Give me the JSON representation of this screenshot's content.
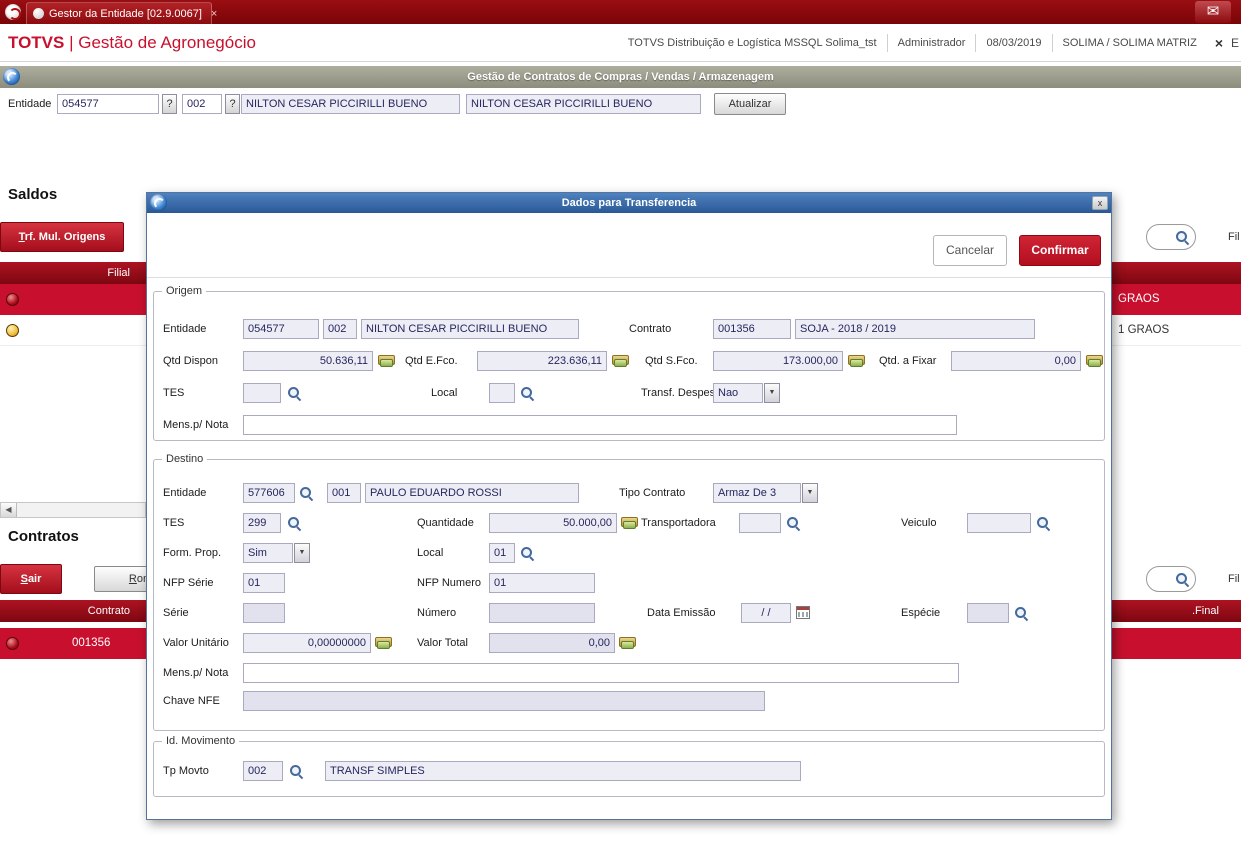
{
  "tabbar": {
    "tab_title": "Gestor da Entidade [02.9.0067]",
    "tab_close": "×"
  },
  "header": {
    "brand_bold": "TOTVS",
    "brand_rest": " | Gestão de Agronegócio",
    "environment": "TOTVS Distribuição e Logística MSSQL Solima_tst",
    "user": "Administrador",
    "date": "08/03/2019",
    "company": "SOLIMA / SOLIMA MATRIZ",
    "close": "×",
    "clipped": "E"
  },
  "banner": {
    "title": "Gestão de Contratos de Compras / Vendas / Armazenagem"
  },
  "entity_bar": {
    "label": "Entidade",
    "code": "054577",
    "help": "?",
    "store": "002",
    "name": "NILTON CESAR PICCIRILLI BUENO",
    "name_copy": "NILTON CESAR PICCIRILLI BUENO",
    "refresh": "Atualizar"
  },
  "saldos": {
    "title": "Saldos",
    "trf_accel": "T",
    "trf_rest": "rf. Mul. Origens",
    "filter_fragment": "Fil",
    "header_filial": "Filial",
    "row1_text": "GRAOS",
    "row2_text": "1 GRAOS",
    "scroll_arrow": "◀"
  },
  "contratos": {
    "title": "Contratos",
    "sair_accel": "S",
    "sair_rest": "air",
    "romaneio_accel": "R",
    "romaneio_rest": "omaneio",
    "filter_fragment": "Fil",
    "header_contrato": "Contrato",
    "header_final": ".Final",
    "row_contrato": "001356"
  },
  "dialog": {
    "title": "Dados para Transferencia",
    "close": "x",
    "cancel": "Cancelar",
    "confirm": "Confirmar",
    "origem": {
      "legend": "Origem",
      "entidade_label": "Entidade",
      "entidade": "054577",
      "loja": "002",
      "nome": "NILTON CESAR PICCIRILLI BUENO",
      "contrato_label": "Contrato",
      "contrato": "001356",
      "contrato_desc": "SOJA  - 2018 / 2019",
      "qtd_dispon_label": "Qtd Dispon",
      "qtd_dispon": "50.636,11",
      "qtd_efco_label": "Qtd E.Fco.",
      "qtd_efco": "223.636,11",
      "qtd_sfco_label": "Qtd S.Fco.",
      "qtd_sfco": "173.000,00",
      "qtd_fixar_label": "Qtd. a Fixar",
      "qtd_fixar": "0,00",
      "tes_label": "TES",
      "tes": "",
      "local_label": "Local",
      "local": "",
      "transf_despesa_label": "Transf. Despesa",
      "transf_despesa": "Nao",
      "dd_arrow": "▼",
      "mens_label": "Mens.p/ Nota",
      "mens": ""
    },
    "destino": {
      "legend": "Destino",
      "entidade_label": "Entidade",
      "entidade": "577606",
      "loja": "001",
      "nome": "PAULO EDUARDO ROSSI",
      "tipo_contrato_label": "Tipo Contrato",
      "tipo_contrato": "Armaz De 3",
      "tes_label": "TES",
      "tes": "299",
      "quantidade_label": "Quantidade",
      "quantidade": "50.000,00",
      "transportadora_label": "Transportadora",
      "transportadora": "",
      "veiculo_label": "Veiculo",
      "veiculo": "",
      "form_prop_label": "Form. Prop.",
      "form_prop": "Sim",
      "local_label": "Local",
      "local": "01",
      "nfp_serie_label": "NFP Série",
      "nfp_serie": "01",
      "nfp_numero_label": "NFP Numero",
      "nfp_numero": "01",
      "serie_label": "Série",
      "serie": "",
      "numero_label": "Número",
      "numero": "",
      "data_emissao_label": "Data Emissão",
      "data_emissao": "/  /",
      "especie_label": "Espécie",
      "especie": "",
      "valor_unitario_label": "Valor Unitário",
      "valor_unitario": "0,00000000",
      "valor_total_label": "Valor Total",
      "valor_total": "0,00",
      "mens_label": "Mens.p/ Nota",
      "mens": "",
      "chave_label": "Chave NFE",
      "chave": "",
      "dd_arrow": "▼"
    },
    "movimento": {
      "legend": "Id. Movimento",
      "tp_movto_label": "Tp Movto",
      "tp_movto": "002",
      "tp_movto_desc": "TRANSF SIMPLES"
    }
  }
}
